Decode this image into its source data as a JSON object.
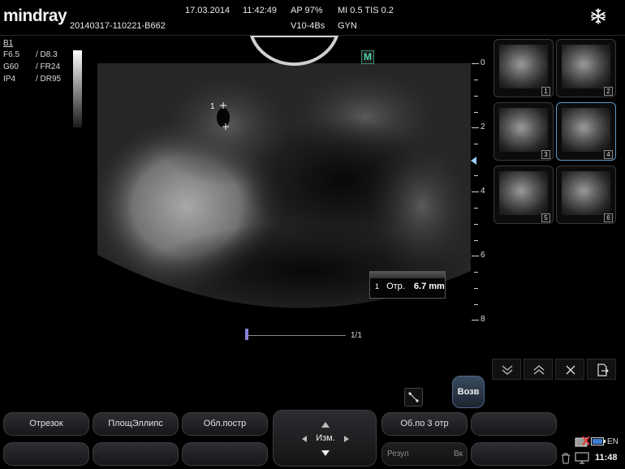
{
  "header": {
    "brand": "mindray",
    "exam_id": "20140317-110221-B662",
    "date": "17.03.2014",
    "time": "11:42:49",
    "ap": "AP  97%",
    "mi_tis": "MI 0.5  TIS 0.2",
    "probe": "V10-4Bs",
    "preset": "GYN",
    "freeze_icon": "snowflake-icon"
  },
  "params": {
    "mode": "B1",
    "freq": "F6.5",
    "depth": "/ D8.3",
    "gain": "G60",
    "frame_rate": "/ FR24",
    "image_proc": "IP4",
    "dyn_range": "/ DR95"
  },
  "image": {
    "orientation_marker": "M",
    "caliper_label": "1"
  },
  "depth_scale": {
    "labels": [
      "0",
      "2",
      "4",
      "6",
      "8"
    ]
  },
  "measurement": {
    "index": "1",
    "name": "Отр.",
    "value": "6.7 mm"
  },
  "cine": {
    "frame": "1/1"
  },
  "thumbnails": [
    {
      "num": "1",
      "selected": false
    },
    {
      "num": "2",
      "selected": false
    },
    {
      "num": "3",
      "selected": false
    },
    {
      "num": "4",
      "selected": true
    },
    {
      "num": "5",
      "selected": false
    },
    {
      "num": "6",
      "selected": false
    }
  ],
  "controls": {
    "page_down_icon": "double-chevron-down-icon",
    "page_up_icon": "double-chevron-up-icon",
    "close_icon": "close-icon",
    "export_icon": "export-icon"
  },
  "softkeys": {
    "segment": "Отрезок",
    "area_ellipse": "ПлощЭллипс",
    "region_build": "Обл.постр",
    "knob_label": "Изм.",
    "area_3seg": "Об.по 3 отр",
    "back": "Возв",
    "result_left": "Резул",
    "result_right": "Вк"
  },
  "status": {
    "language": "EN",
    "clock": "11:48"
  },
  "colors": {
    "accent": "#4fd1a8",
    "selection": "#5f9ac7",
    "back_button": "#3a4a5e"
  }
}
